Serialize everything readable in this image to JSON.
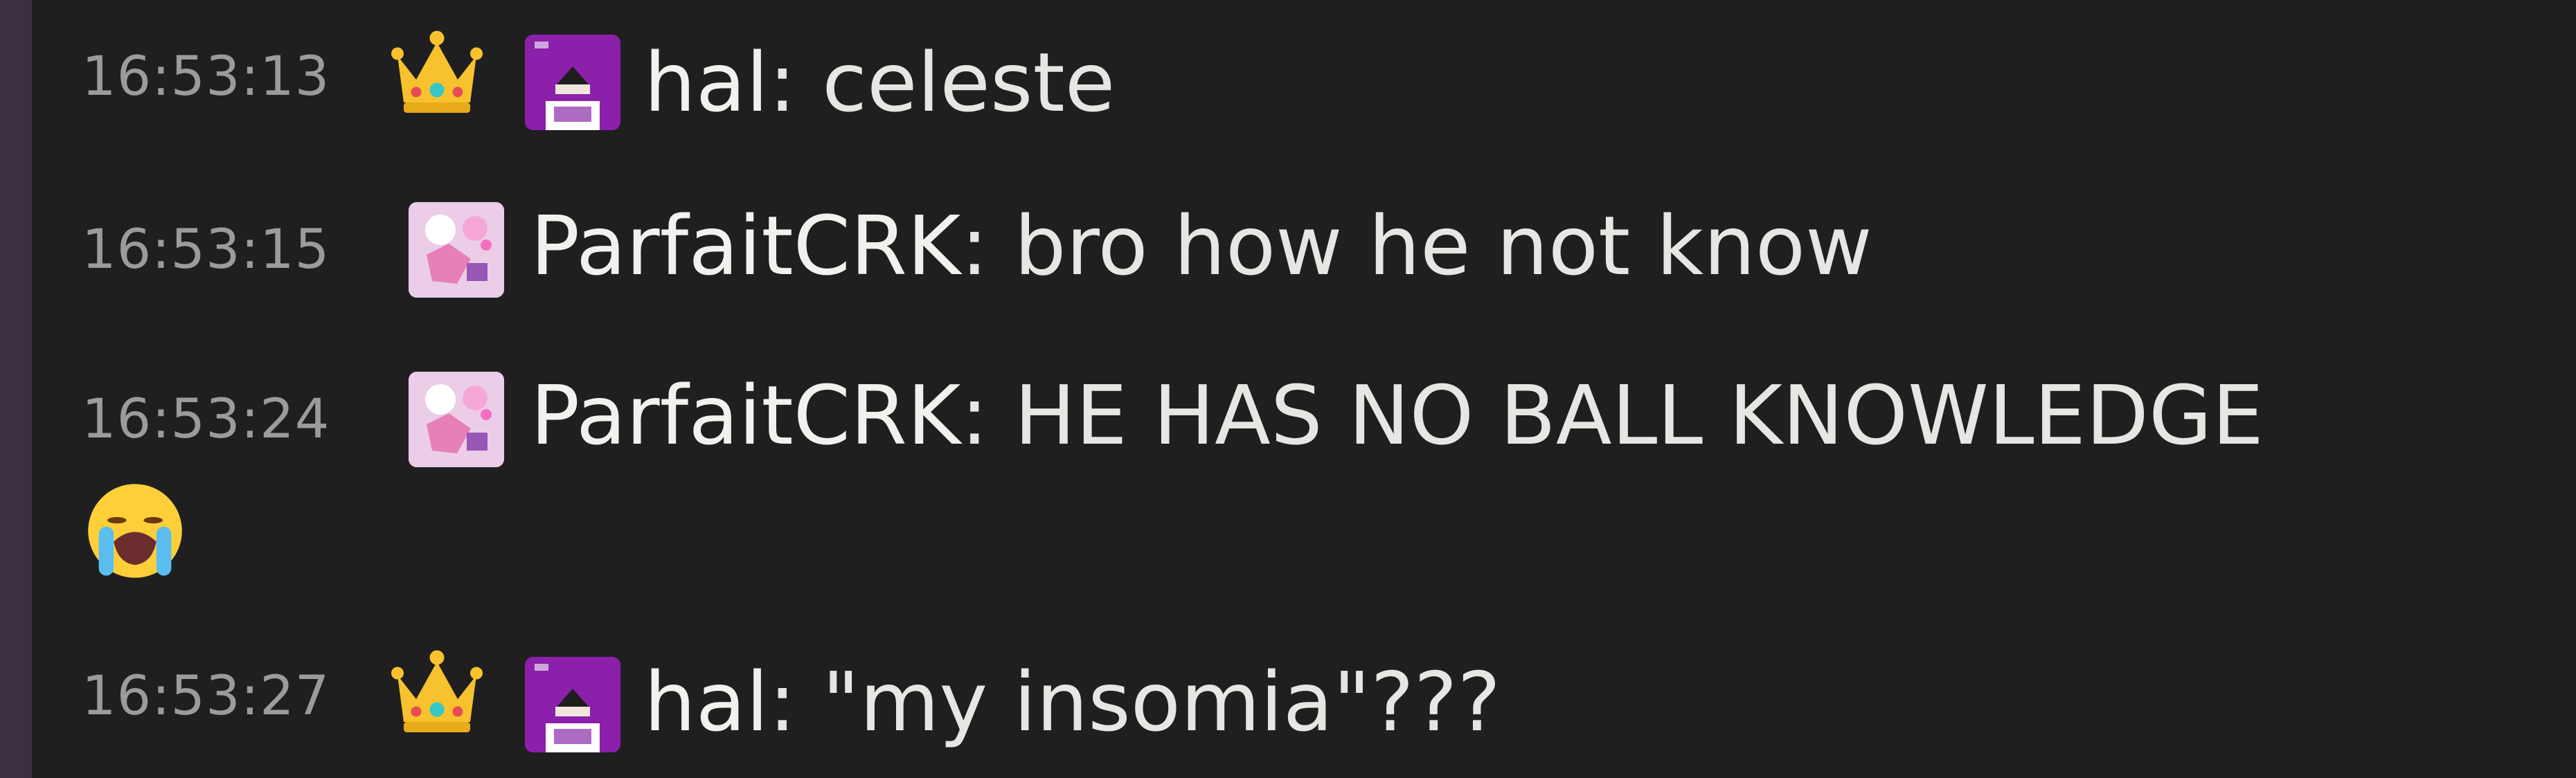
{
  "messages": [
    {
      "time": "16:53:13",
      "user": "hal",
      "separator": ":",
      "text": "celeste",
      "badge": "crown-icon",
      "avatar": "hal-avatar"
    },
    {
      "time": "16:53:15",
      "user": "ParfaitCRK",
      "separator": ":",
      "text": "bro how he not know",
      "avatar": "parfaitcrk-avatar"
    },
    {
      "time": "16:53:24",
      "user": "ParfaitCRK",
      "separator": ":",
      "text": "HE HAS NO BALL KNOWLEDGE",
      "avatar": "parfaitcrk-avatar",
      "trailing_emoji": "loudly-crying-face-icon"
    },
    {
      "time": "16:53:27",
      "user": "hal",
      "separator": ":",
      "text": "\"my insomia\"???",
      "badge": "crown-icon",
      "avatar": "hal-avatar"
    }
  ],
  "colors": {
    "background": "#1f1f20",
    "left_strip": "#3a3040",
    "timestamp": "#9b9b9b",
    "message_text": "#e8e6e3"
  }
}
